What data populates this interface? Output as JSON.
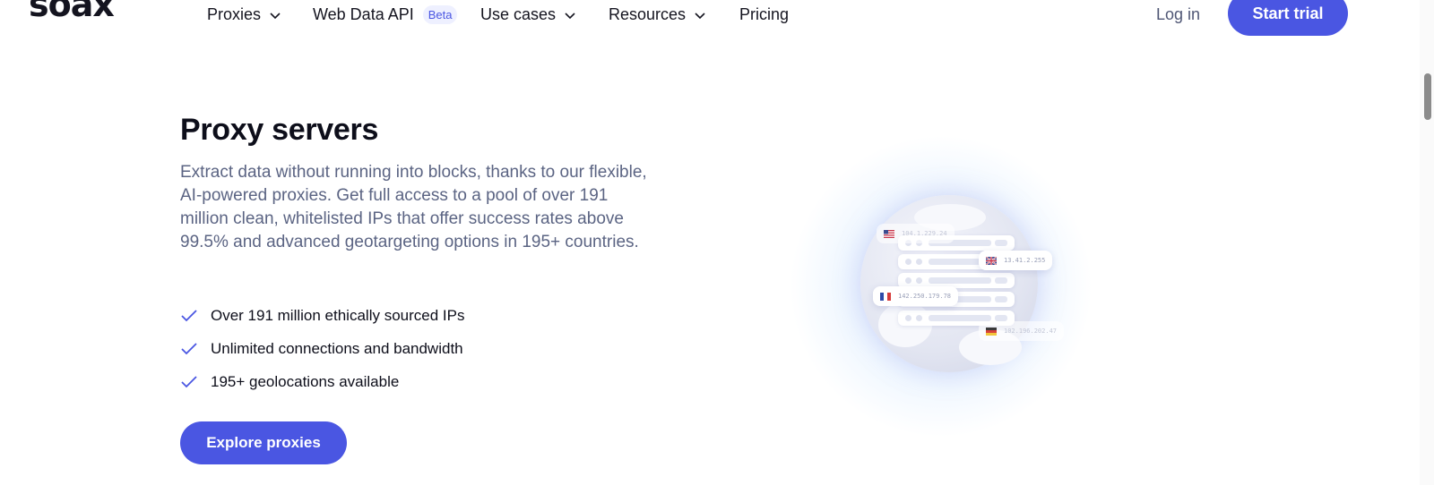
{
  "header": {
    "logo": "soax",
    "nav": [
      {
        "label": "Proxies",
        "has_dropdown": true
      },
      {
        "label": "Web Data API",
        "badge": "Beta",
        "has_dropdown": false
      },
      {
        "label": "Use cases",
        "has_dropdown": true
      },
      {
        "label": "Resources",
        "has_dropdown": true
      },
      {
        "label": "Pricing",
        "has_dropdown": false
      }
    ],
    "login_label": "Log in",
    "start_trial_label": "Start trial"
  },
  "hero": {
    "title": "Proxy servers",
    "description": "Extract data without running into blocks, thanks to our flexible, AI-powered proxies. Get full access to a pool of over 191 million clean, whitelisted IPs that offer success rates above 99.5% and advanced geotargeting options in 195+ countries.",
    "features": [
      "Over 191 million ethically sourced IPs",
      "Unlimited connections and bandwidth",
      "195+ geolocations available"
    ],
    "cta_label": "Explore proxies"
  },
  "illustration": {
    "ip_tags": [
      {
        "flag": "us-flag-icon",
        "ip": "104.1.229.24"
      },
      {
        "flag": "uk-flag-icon",
        "ip": "13.41.2.255"
      },
      {
        "flag": "france-flag-icon",
        "ip": "142.250.179.78"
      },
      {
        "flag": "germany-flag-icon",
        "ip": "102.196.202.47"
      }
    ]
  },
  "colors": {
    "accent": "#4a56e2",
    "text_dark": "#0d0e1a",
    "text_muted": "#5b6483"
  }
}
